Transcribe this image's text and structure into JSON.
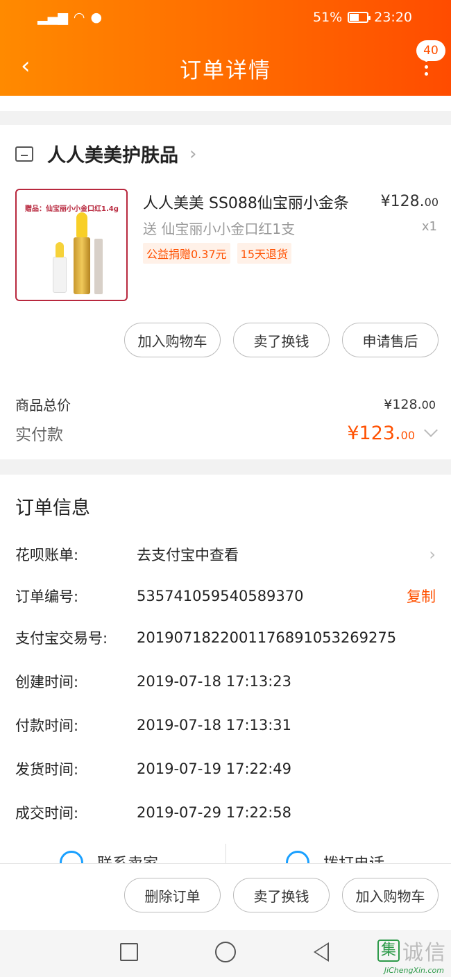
{
  "status_bar": {
    "battery_text": "51%",
    "battery_level": 0.51,
    "time": "23:20"
  },
  "header": {
    "title": "订单详情",
    "badge_count": "40",
    "back_glyph": "‹",
    "menu_icon": "more-vert-icon"
  },
  "shop": {
    "name": "人人美美护肤品"
  },
  "product": {
    "title": "人人美美 SS088仙宝丽小金条",
    "price_main": "¥128.",
    "price_cents": "00",
    "gift": "送 仙宝丽小小金口红1支",
    "qty": "x1",
    "image_caption": "赠品：仙宝丽小小金口红1.4g",
    "tags": [
      "公益捐赠0.37元",
      "15天退货"
    ]
  },
  "item_actions": [
    "加入购物车",
    "卖了换钱",
    "申请售后"
  ],
  "summary": {
    "total_label": "商品总价",
    "total_main": "¥128.",
    "total_cents": "00",
    "paid_label": "实付款",
    "paid_main": "¥123.",
    "paid_cents": "00"
  },
  "order_info": {
    "title": "订单信息",
    "rows": [
      {
        "label": "花呗账单:",
        "value": "去支付宝中查看"
      },
      {
        "label": "订单编号:",
        "value": "535741059540589370",
        "action": "复制"
      },
      {
        "label": "支付宝交易号:",
        "value": "2019071822001176891053269275"
      },
      {
        "label": "创建时间:",
        "value": "2019-07-18 17:13:23"
      },
      {
        "label": "付款时间:",
        "value": "2019-07-18 17:13:31"
      },
      {
        "label": "发货时间:",
        "value": "2019-07-19 17:22:49"
      },
      {
        "label": "成交时间:",
        "value": "2019-07-29 17:22:58"
      }
    ]
  },
  "contact": {
    "seller": "联系卖家",
    "call": "拨打电话"
  },
  "bottom_actions": [
    "删除订单",
    "卖了换钱",
    "加入购物车"
  ],
  "watermark": {
    "logo": "集",
    "text": "诚信",
    "url": "JiChengXin.com"
  },
  "colors": {
    "accent": "#ff5000",
    "header_start": "#ff8a00",
    "header_end": "#ff4c00"
  }
}
